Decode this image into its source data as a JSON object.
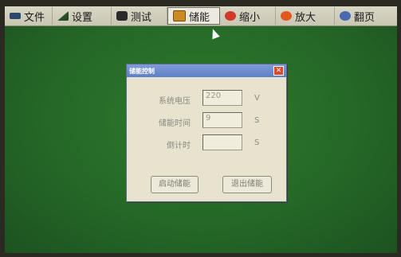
{
  "menu": {
    "items": [
      {
        "label": "文件",
        "icon": "file-icon"
      },
      {
        "label": "设置",
        "icon": "settings-icon"
      },
      {
        "label": "测试",
        "icon": "test-icon"
      },
      {
        "label": "储能",
        "icon": "storage-icon"
      },
      {
        "label": "缩小",
        "icon": "zoom-out-icon"
      },
      {
        "label": "放大",
        "icon": "zoom-in-icon"
      },
      {
        "label": "翻页",
        "icon": "page-icon"
      }
    ]
  },
  "dialog": {
    "title": "储能控制",
    "close": "✕",
    "fields": [
      {
        "label": "系统电压",
        "value": "220",
        "unit": "V"
      },
      {
        "label": "储能时间",
        "value": "9",
        "unit": "S"
      },
      {
        "label": "倒计时",
        "value": "",
        "unit": "S"
      }
    ],
    "start_button": "启动储能",
    "exit_button": "退出储能"
  },
  "colors": {
    "background": "#256827",
    "menubar": "#d9d6c6",
    "dialog": "#e7e3cf",
    "titlebar": "#6a88cf",
    "close": "#d84a2c"
  }
}
